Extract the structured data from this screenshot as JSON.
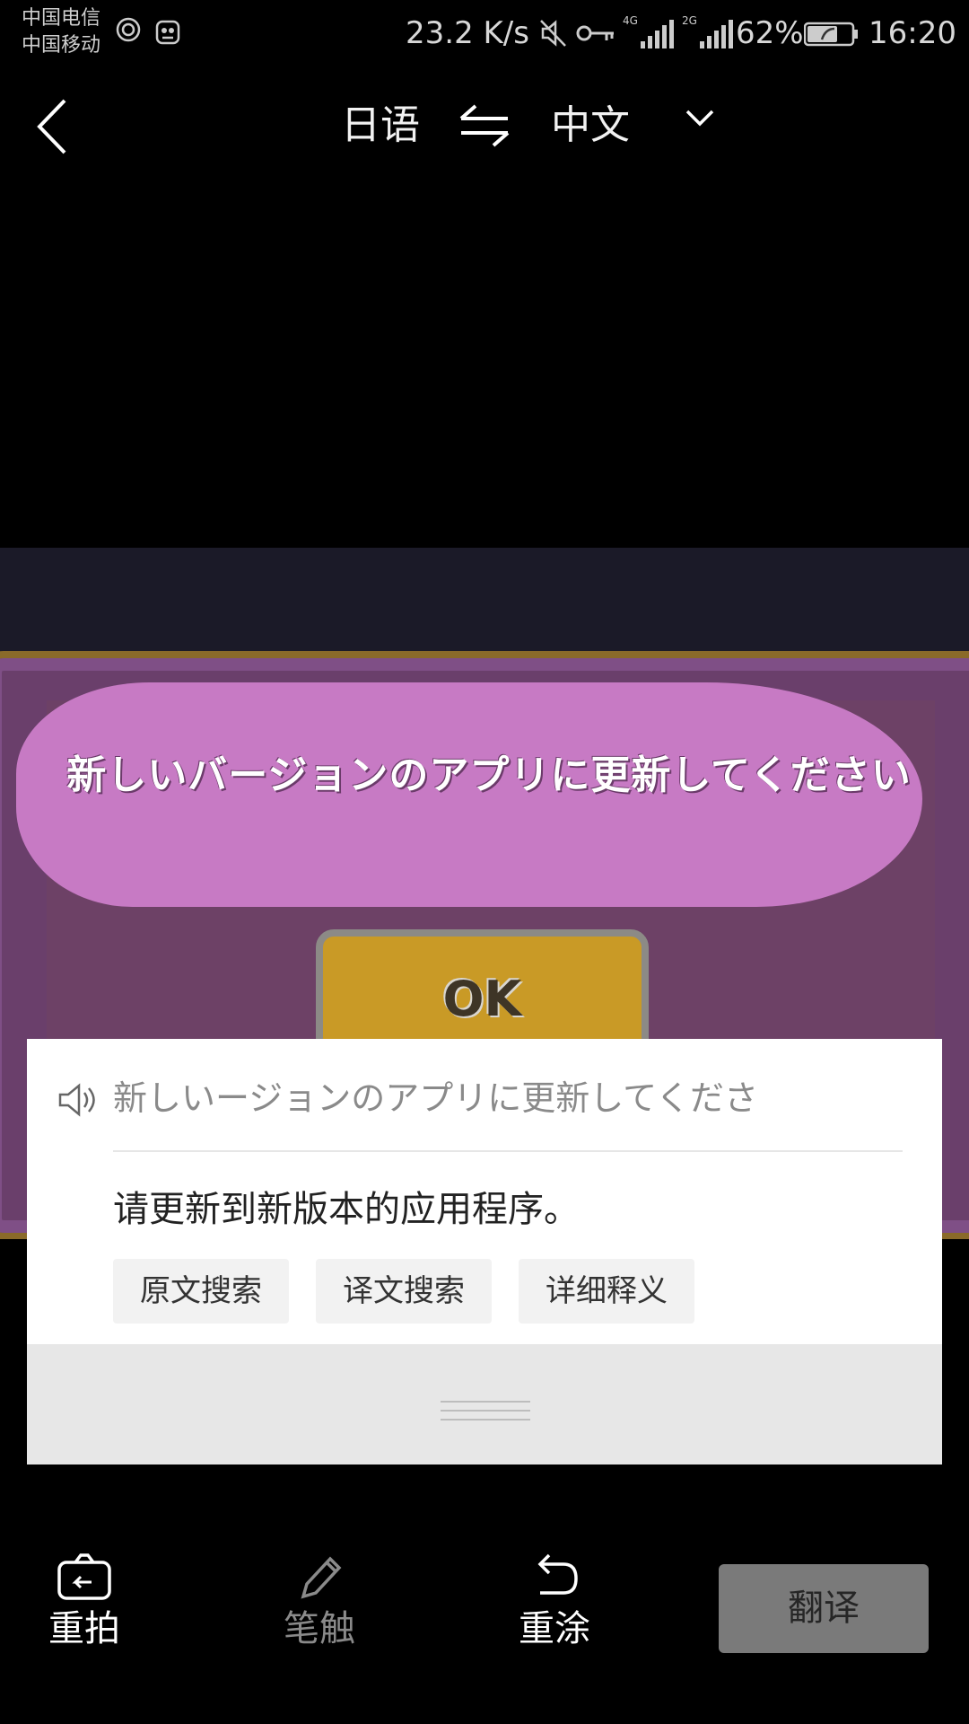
{
  "status_bar": {
    "carrier_1": "中国电信",
    "carrier_2": "中国移动",
    "net_speed": "23.2 K/s",
    "battery": "62%",
    "time": "16:20",
    "net_1": "4G",
    "net_2": "2G"
  },
  "nav": {
    "source_lang": "日语",
    "target_lang": "中文"
  },
  "photo": {
    "dialog_text": "新しいバージョンのアプリに更新してください",
    "ok_label": "OK"
  },
  "result": {
    "source_text": "新しいージョンのアプリに更新してくださ",
    "translation": "请更新到新版本的应用程序。",
    "chips": [
      "原文搜索",
      "译文搜索",
      "详细释义"
    ]
  },
  "toolbar": {
    "retake_label": "重拍",
    "brush_label": "笔触",
    "repaint_label": "重涂",
    "translate_label": "翻译"
  }
}
